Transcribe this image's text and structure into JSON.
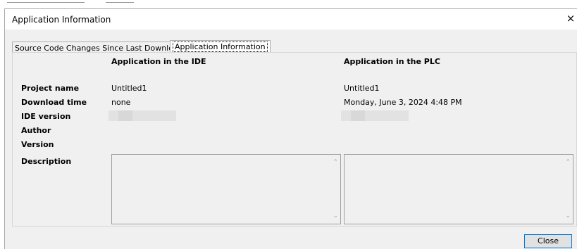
{
  "window": {
    "title": "Application Information",
    "close_glyph": "×"
  },
  "tabs": [
    {
      "label": "Source Code Changes Since Last Download",
      "selected": false
    },
    {
      "label": "Application Information",
      "selected": true
    }
  ],
  "columns": {
    "ide_header": "Application in the IDE",
    "plc_header": "Application in the PLC"
  },
  "fields": {
    "project_name": {
      "label": "Project name",
      "ide": "Untitled1",
      "plc": "Untitled1"
    },
    "download_time": {
      "label": "Download time",
      "ide": "none",
      "plc": "Monday, June 3, 2024 4:48 PM"
    },
    "ide_version": {
      "label": "IDE version",
      "ide": "",
      "plc": ""
    },
    "author": {
      "label": "Author"
    },
    "version": {
      "label": "Version"
    },
    "description": {
      "label": "Description",
      "ide": "",
      "plc": ""
    }
  },
  "buttons": {
    "close_label": "Close"
  },
  "colors": {
    "dialog_bg": "#f0f0f0",
    "accent": "#0078d7"
  }
}
